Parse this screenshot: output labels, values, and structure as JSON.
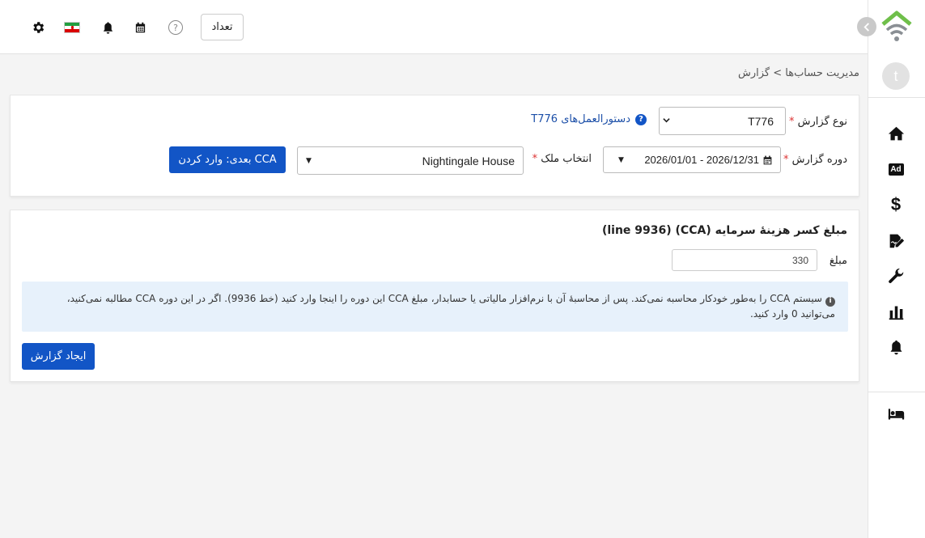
{
  "topbar": {
    "count_button": "تعداد",
    "icons": [
      "settings-icon",
      "iran-flag",
      "bell-icon",
      "calendar-icon",
      "help-icon"
    ],
    "help_glyph": "?"
  },
  "sidebar": {
    "avatar_letter": "t",
    "items": [
      "home-icon",
      "ad-icon",
      "dollar-icon",
      "signature-icon",
      "wrench-icon",
      "bar-chart-icon",
      "bell-icon",
      "bed-icon"
    ],
    "ad_text": "Ad",
    "dollar_text": "$"
  },
  "breadcrumb": "مدیریت حساب‌ها > گزارش",
  "form": {
    "report_type_label": "نوع گزارش",
    "required_mark": "*",
    "report_type_value": "T776",
    "instructions_link": "دستورالعمل‌های T776",
    "period_label": "دوره گزارش",
    "period_value": "2026/01/01 - 2026/12/31",
    "property_label": "انتخاب ملک",
    "property_value": "Nightingale House",
    "next_button": "بعدی: وارد کردن CCA"
  },
  "cca": {
    "title": "مبلغ کسر هزینهٔ سرمایه (CCA)  (line 9936)",
    "amount_label": "مبلغ",
    "amount_value": "330",
    "info_text": "سیستم CCA را به‌طور خودکار محاسبه نمی‌کند. پس از محاسبهٔ آن با نرم‌افزار مالیاتی یا حسابدار، مبلغ CCA این دوره را اینجا وارد کنید (خط 9936). اگر در این دوره CCA مطالبه نمی‌کنید، می‌توانید 0 وارد کنید.",
    "create_button": "ایجاد گزارش"
  },
  "colors": {
    "primary": "#1255c6",
    "info_bg": "#e7f1fb",
    "logo_green": "#6fbf4a",
    "logo_gray": "#8a8f94"
  }
}
